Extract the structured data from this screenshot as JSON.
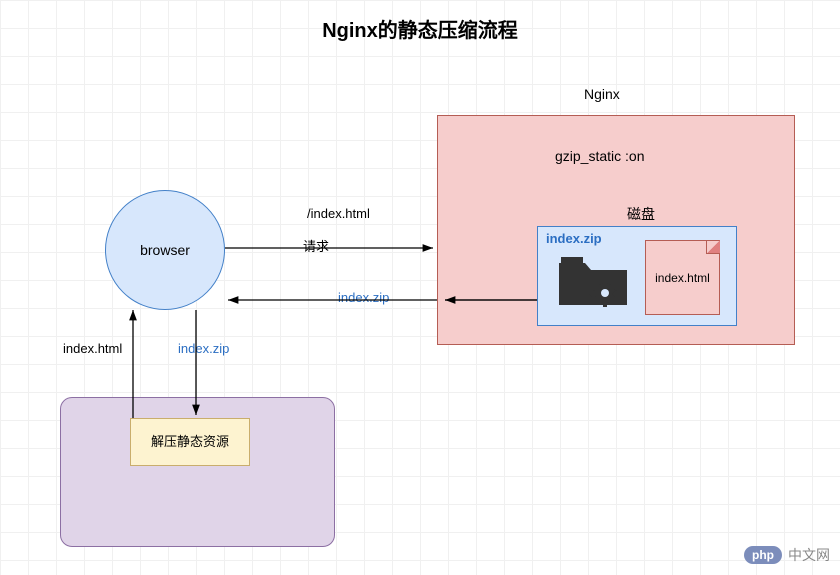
{
  "title": "Nginx的静态压缩流程",
  "nginx_label": "Nginx",
  "gzip_label": "gzip_static :on",
  "disk_label": "磁盘",
  "zip_label": "index.zip",
  "file_label": "index.html",
  "browser_label": "browser",
  "request_path": "/index.html",
  "request_text": "请求",
  "response_zip": "index.zip",
  "down_label": "index.zip",
  "up_label": "index.html",
  "decompress_label": "解压静态资源",
  "watermark": {
    "php": "php",
    "cn": "中文网"
  }
}
